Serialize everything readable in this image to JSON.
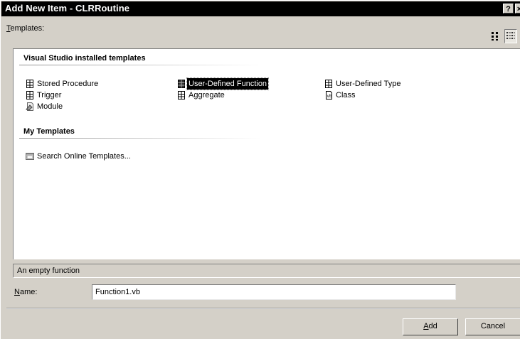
{
  "window": {
    "title": "Add New Item - CLRRoutine",
    "help_label": "?",
    "close_label": "×"
  },
  "templates_label": "Templates:",
  "groups": [
    {
      "header": "Visual Studio installed templates",
      "items": [
        {
          "label": "Stored Procedure",
          "icon": "code-file-icon"
        },
        {
          "label": "User-Defined Function",
          "icon": "code-file-icon",
          "selected": true
        },
        {
          "label": "User-Defined Type",
          "icon": "code-file-icon"
        },
        {
          "label": "Trigger",
          "icon": "code-file-icon"
        },
        {
          "label": "Aggregate",
          "icon": "code-file-icon"
        },
        {
          "label": "Class",
          "icon": "class-file-icon"
        },
        {
          "label": "Module",
          "icon": "module-icon"
        }
      ]
    },
    {
      "header": "My Templates",
      "items": [
        {
          "label": "Search Online Templates...",
          "icon": "search-online-icon"
        }
      ]
    }
  ],
  "description": "An empty function",
  "name_label": "Name:",
  "name_value": "Function1.vb",
  "buttons": {
    "add": "Add",
    "cancel": "Cancel"
  }
}
